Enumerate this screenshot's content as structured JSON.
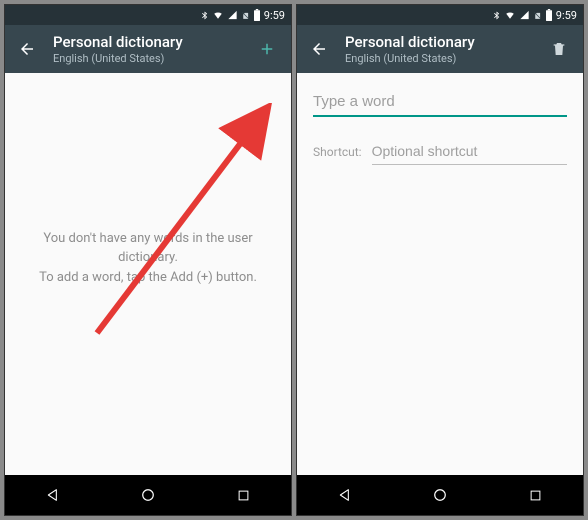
{
  "status": {
    "time": "9:59"
  },
  "left": {
    "title": "Personal dictionary",
    "subtitle": "English (United States)",
    "empty_line1": "You don't have any words in the user dictionary.",
    "empty_line2": "To add a word, tap the Add (+) button."
  },
  "right": {
    "title": "Personal dictionary",
    "subtitle": "English (United States)",
    "word_placeholder": "Type a word",
    "shortcut_label": "Shortcut:",
    "shortcut_placeholder": "Optional shortcut"
  }
}
